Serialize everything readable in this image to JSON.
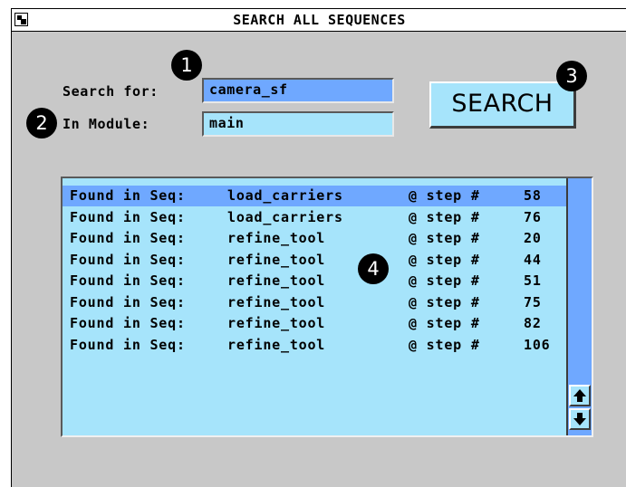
{
  "window": {
    "title": "SEARCH ALL SEQUENCES"
  },
  "form": {
    "search_label": "Search for:",
    "search_value": "camera_sf",
    "module_label": "In Module:",
    "module_value": "main"
  },
  "search_button": {
    "label": "SEARCH"
  },
  "results": [
    {
      "prefix": "Found in Seq:",
      "sequence": "load_carriers",
      "at": "@ step #",
      "step": "58"
    },
    {
      "prefix": "Found in Seq:",
      "sequence": "load_carriers",
      "at": "@ step #",
      "step": "76"
    },
    {
      "prefix": "Found in Seq:",
      "sequence": "refine_tool",
      "at": "@ step #",
      "step": "20"
    },
    {
      "prefix": "Found in Seq:",
      "sequence": "refine_tool",
      "at": "@ step #",
      "step": "44"
    },
    {
      "prefix": "Found in Seq:",
      "sequence": "refine_tool",
      "at": "@ step #",
      "step": "51"
    },
    {
      "prefix": "Found in Seq:",
      "sequence": "refine_tool",
      "at": "@ step #",
      "step": "75"
    },
    {
      "prefix": "Found in Seq:",
      "sequence": "refine_tool",
      "at": "@ step #",
      "step": "82"
    },
    {
      "prefix": "Found in Seq:",
      "sequence": "refine_tool",
      "at": "@ step #",
      "step": "106"
    }
  ],
  "selected_row": 0,
  "scroll_icons": {
    "up": "arrow-up-icon",
    "down": "arrow-down-icon"
  },
  "callouts": [
    "1",
    "2",
    "3",
    "4"
  ],
  "colors": {
    "background": "#c8c8c8",
    "field": "#a6e4fb",
    "selection": "#6fa8ff"
  }
}
